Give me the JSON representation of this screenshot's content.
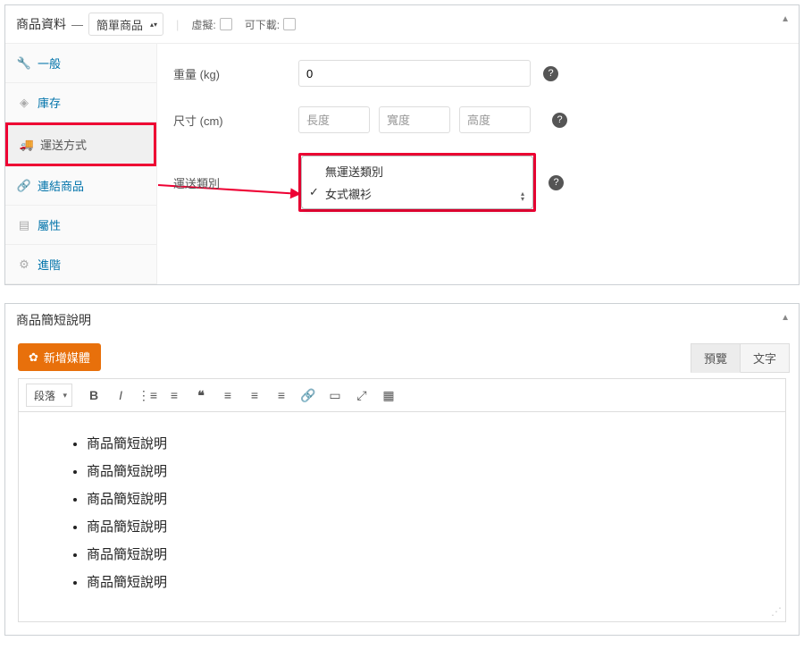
{
  "productData": {
    "title": "商品資料",
    "typeSelected": "簡單商品",
    "virtualLabel": "虛擬:",
    "downloadableLabel": "可下載:",
    "tabs": [
      {
        "id": "general",
        "label": "一般",
        "icon": "wrench"
      },
      {
        "id": "inventory",
        "label": "庫存",
        "icon": "diamond"
      },
      {
        "id": "shipping",
        "label": "運送方式",
        "icon": "truck"
      },
      {
        "id": "linked",
        "label": "連結商品",
        "icon": "link"
      },
      {
        "id": "attributes",
        "label": "屬性",
        "icon": "list"
      },
      {
        "id": "advanced",
        "label": "進階",
        "icon": "gear"
      }
    ],
    "activeTab": "shipping",
    "weightLabel": "重量 (kg)",
    "weightValue": "0",
    "dimLabel": "尺寸 (cm)",
    "dimPlaceholders": {
      "length": "長度",
      "width": "寬度",
      "height": "高度"
    },
    "shippingClassLabel": "運送類別",
    "shippingOptions": [
      {
        "label": "無運送類別",
        "selected": false
      },
      {
        "label": "女式襯衫",
        "selected": true
      }
    ]
  },
  "shortDesc": {
    "title": "商品簡短說明",
    "addMedia": "新增媒體",
    "editorTabs": {
      "visual": "預覽",
      "text": "文字"
    },
    "formatSelect": "段落",
    "items": [
      "商品簡短說明",
      "商品簡短說明",
      "商品簡短說明",
      "商品簡短說明",
      "商品簡短說明",
      "商品簡短說明"
    ]
  }
}
